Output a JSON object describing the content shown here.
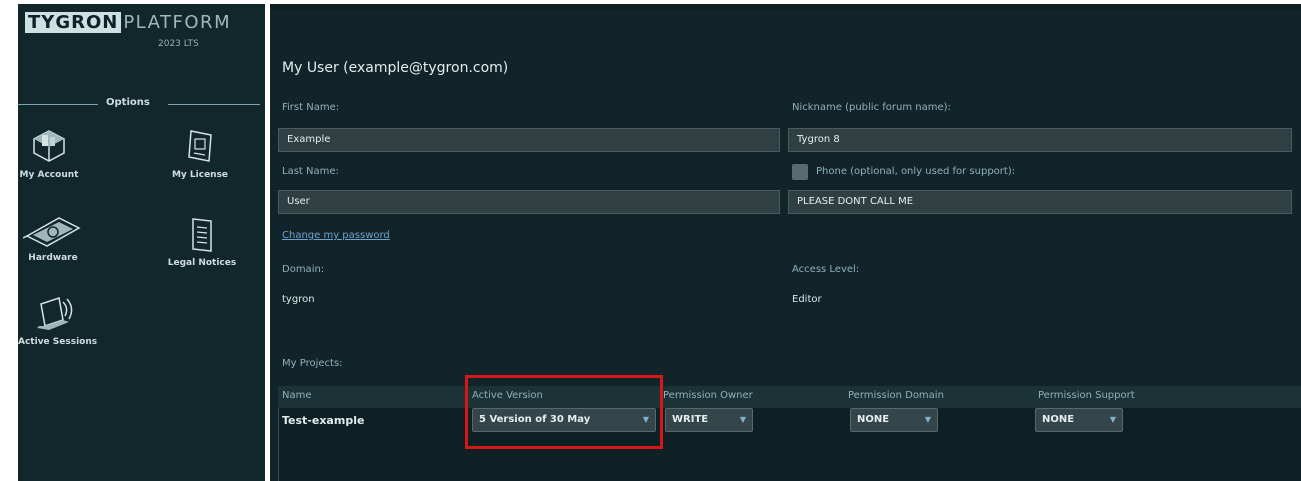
{
  "app": {
    "brand": "TYGRON",
    "platform": "PLATFORM",
    "version": "2023 LTS"
  },
  "sidebar": {
    "section_title": "Options",
    "items": [
      {
        "label": "My Account",
        "icon": "city-blocks-icon"
      },
      {
        "label": "My License",
        "icon": "license-card-icon"
      },
      {
        "label": "Hardware",
        "icon": "graphics-card-icon"
      },
      {
        "label": "Legal Notices",
        "icon": "document-icon"
      },
      {
        "label": "Active Sessions",
        "icon": "laptop-wifi-icon"
      }
    ]
  },
  "user": {
    "title": "My User (example@tygron.com)",
    "first_name_label": "First Name:",
    "first_name_value": "Example",
    "nickname_label": "Nickname (public forum name):",
    "nickname_value": "Tygron 8",
    "last_name_label": "Last Name:",
    "last_name_value": "User",
    "phone_label": "Phone (optional, only used for support):",
    "phone_value": "PLEASE DONT CALL ME",
    "change_password": "Change my password",
    "domain_label": "Domain:",
    "domain_value": "tygron",
    "access_label": "Access Level:",
    "access_value": "Editor"
  },
  "projects": {
    "title": "My Projects:",
    "columns": [
      "Name",
      "Active Version",
      "Permission Owner",
      "Permission Domain",
      "Permission Support"
    ],
    "rows": [
      {
        "name": "Test-example",
        "active_version": "5 Version of 30 May",
        "permission_owner": "WRITE",
        "permission_domain": "NONE",
        "permission_support": "NONE"
      }
    ]
  },
  "colors": {
    "background": "#112429",
    "sidebar": "#12272c",
    "highlight": "#d61717",
    "link": "#6fa3cf"
  }
}
